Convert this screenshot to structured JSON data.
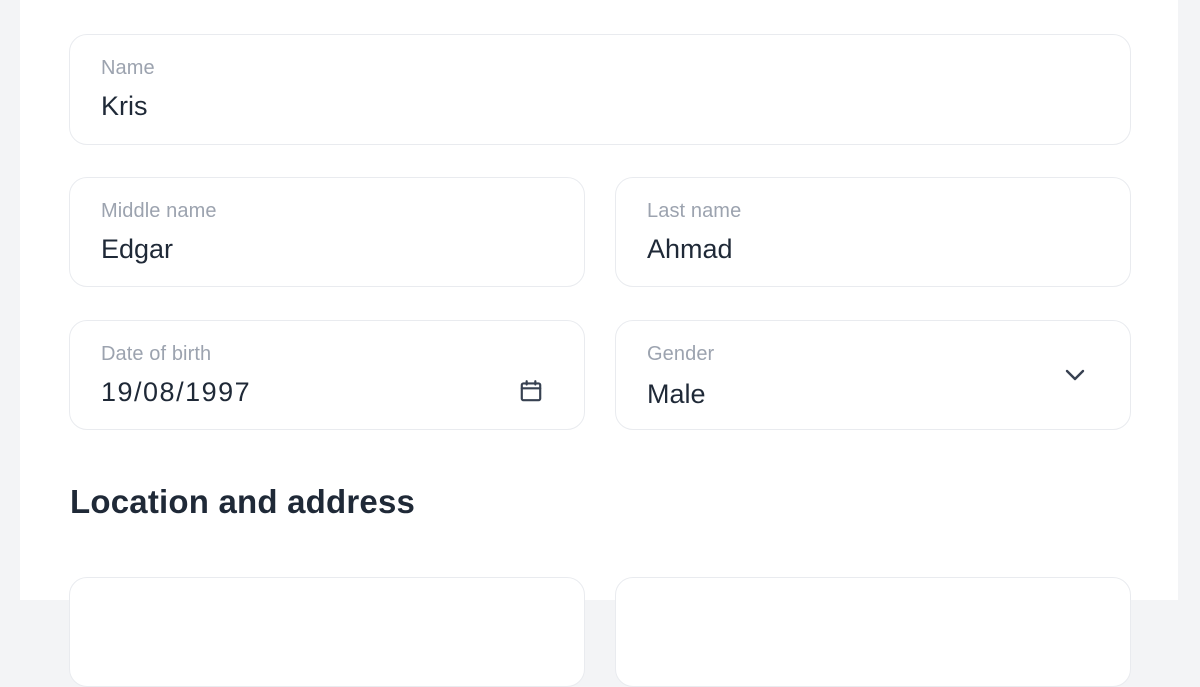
{
  "form": {
    "name": {
      "label": "Name",
      "value": "Kris"
    },
    "middle_name": {
      "label": "Middle name",
      "value": "Edgar"
    },
    "last_name": {
      "label": "Last name",
      "value": "Ahmad"
    },
    "date_of_birth": {
      "label": "Date of birth",
      "value": "19/08/1997",
      "icon": "calendar-icon"
    },
    "gender": {
      "label": "Gender",
      "value": "Male",
      "icon": "chevron-down-icon"
    }
  },
  "location_section": {
    "heading": "Location and address"
  },
  "colors": {
    "page_background": "#f3f4f6",
    "card_background": "#ffffff",
    "field_border": "#e9ebef",
    "label_text": "#9ca3af",
    "value_text": "#1f2937"
  }
}
